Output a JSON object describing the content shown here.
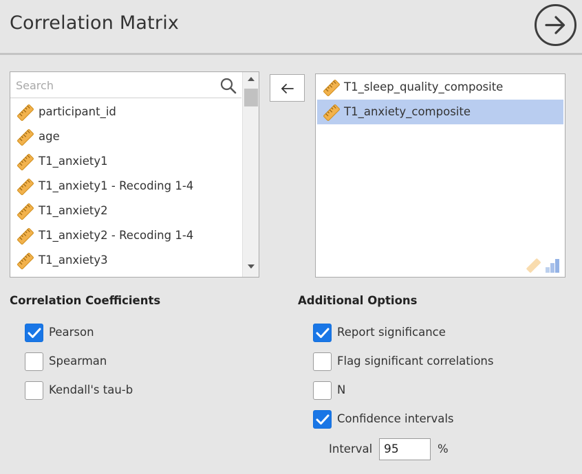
{
  "header": {
    "title": "Correlation Matrix"
  },
  "available": {
    "search_placeholder": "Search",
    "items": [
      {
        "label": "participant_id",
        "icon": "scale-ruler-icon"
      },
      {
        "label": "age",
        "icon": "scale-ruler-icon"
      },
      {
        "label": "T1_anxiety1",
        "icon": "scale-ruler-icon"
      },
      {
        "label": "T1_anxiety1 - Recoding 1-4",
        "icon": "scale-ruler-icon"
      },
      {
        "label": "T1_anxiety2",
        "icon": "scale-ruler-icon"
      },
      {
        "label": "T1_anxiety2 - Recoding 1-4",
        "icon": "scale-ruler-icon"
      },
      {
        "label": "T1_anxiety3",
        "icon": "scale-ruler-icon"
      }
    ]
  },
  "selected": {
    "items": [
      {
        "label": "T1_sleep_quality_composite",
        "icon": "scale-ruler-icon",
        "highlighted": false
      },
      {
        "label": "T1_anxiety_composite",
        "icon": "scale-ruler-icon",
        "highlighted": true
      }
    ]
  },
  "coefficients": {
    "title": "Correlation Coefficients",
    "options": [
      {
        "label": "Pearson",
        "checked": true
      },
      {
        "label": "Spearman",
        "checked": false
      },
      {
        "label": "Kendall's tau-b",
        "checked": false
      }
    ]
  },
  "additional": {
    "title": "Additional Options",
    "options": [
      {
        "label": "Report significance",
        "checked": true
      },
      {
        "label": "Flag significant correlations",
        "checked": false
      },
      {
        "label": "N",
        "checked": false
      },
      {
        "label": "Confidence intervals",
        "checked": true
      }
    ],
    "interval_label": "Interval",
    "interval_value": "95",
    "interval_unit": "%"
  },
  "colors": {
    "accent": "#1976e6",
    "selection": "#b9cdf0",
    "ruler": "#f2b24c"
  }
}
